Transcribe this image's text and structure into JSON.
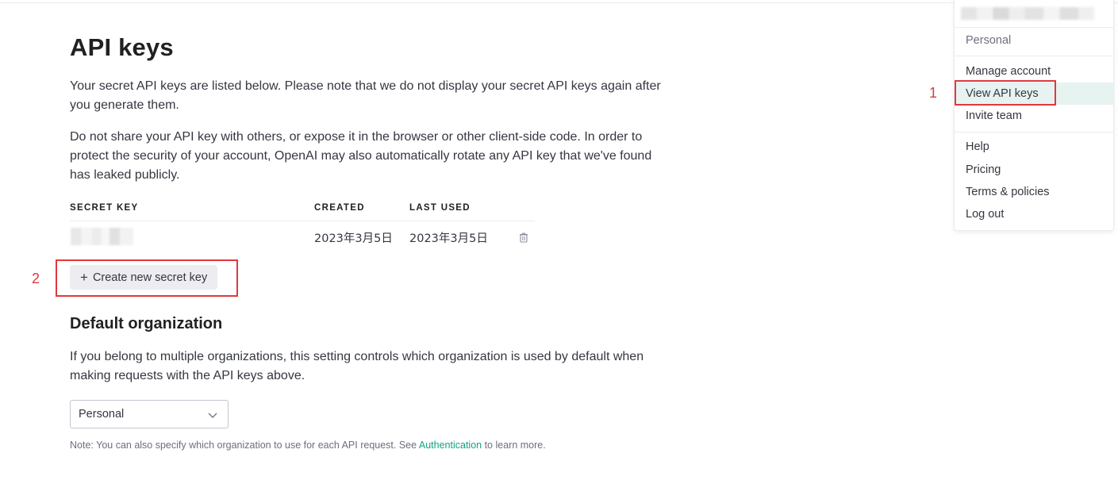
{
  "page": {
    "title": "API keys",
    "intro_1": "Your secret API keys are listed below. Please note that we do not display your secret API keys again after you generate them.",
    "intro_2": "Do not share your API key with others, or expose it in the browser or other client-side code. In order to protect the security of your account, OpenAI may also automatically rotate any API key that we've found has leaked publicly."
  },
  "keys_table": {
    "headers": [
      "SECRET KEY",
      "CREATED",
      "LAST USED"
    ],
    "rows": [
      {
        "created": "2023年3月5日",
        "last_used": "2023年3月5日",
        "action_icon": "trash-icon"
      }
    ]
  },
  "create_button": {
    "icon": "plus-icon",
    "label": "Create new secret key"
  },
  "default_org": {
    "heading": "Default organization",
    "description": "If you belong to multiple organizations, this setting controls which organization is used by default when making requests with the API keys above.",
    "selected": "Personal",
    "note_prefix": "Note: You can also specify which organization to use for each API request. See ",
    "note_link": "Authentication",
    "note_suffix": " to learn more."
  },
  "account_menu": {
    "org_label": "Personal",
    "items_group_1": [
      "Manage account",
      "View API keys",
      "Invite team"
    ],
    "items_group_2": [
      "Help",
      "Pricing",
      "Terms & policies",
      "Log out"
    ],
    "active_item": "View API keys"
  },
  "annotations": {
    "step_1": "1",
    "step_2": "2",
    "color": "#e0383e"
  },
  "colors": {
    "link": "#10a37f",
    "button_bg": "#ececf1",
    "active_item_bg": "#e7f3f1"
  }
}
